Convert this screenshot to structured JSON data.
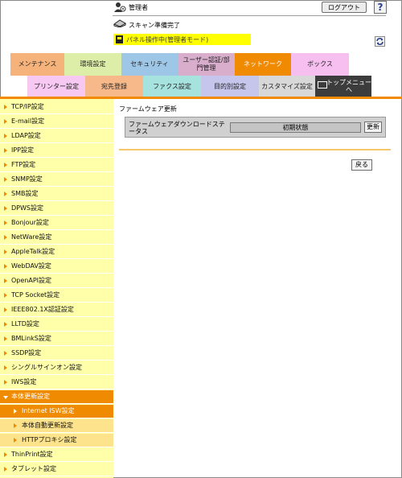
{
  "header": {
    "admin_label": "管理者",
    "logout_label": "ログアウト",
    "help_label": "?",
    "scan_status": "スキャン準備完了",
    "panel_status": "パネル操作中(管理者モード)"
  },
  "main_tabs": [
    {
      "label": "メンテナンス",
      "color": "#f5b27a"
    },
    {
      "label": "環境設定",
      "color": "#ddeea8"
    },
    {
      "label": "セキュリティ",
      "color": "#9ec6e6"
    },
    {
      "label": "ユーザー認証/部門管理",
      "color": "#d8aecc"
    },
    {
      "label": "ネットワーク",
      "color": "#f08a00"
    },
    {
      "label": "ボックス",
      "color": "#f6bff0"
    }
  ],
  "sub_tabs": [
    {
      "label": "プリンター設定",
      "color": "#f6c8f2"
    },
    {
      "label": "宛先登録",
      "color": "#f8b98a"
    },
    {
      "label": "ファクス設定",
      "color": "#a6e2de"
    },
    {
      "label": "目的別設定",
      "color": "#c6c6ec"
    },
    {
      "label": "カスタマイズ設定",
      "color": "#d8d8d8"
    },
    {
      "label": "トップメニューへ",
      "color": "#3c3c3c"
    }
  ],
  "sidebar": {
    "items": [
      {
        "label": "TCP/IP設定"
      },
      {
        "label": "E-mail設定"
      },
      {
        "label": "LDAP設定"
      },
      {
        "label": "IPP設定"
      },
      {
        "label": "FTP設定"
      },
      {
        "label": "SNMP設定"
      },
      {
        "label": "SMB設定"
      },
      {
        "label": "DPWS設定"
      },
      {
        "label": "Bonjour設定"
      },
      {
        "label": "NetWare設定"
      },
      {
        "label": "AppleTalk設定"
      },
      {
        "label": "WebDAV設定"
      },
      {
        "label": "OpenAPI設定"
      },
      {
        "label": "TCP Socket設定"
      },
      {
        "label": "IEEE802.1X認証設定"
      },
      {
        "label": "LLTD設定"
      },
      {
        "label": "BMLinkS設定"
      },
      {
        "label": "SSDP設定"
      },
      {
        "label": "シングルサインオン設定"
      },
      {
        "label": "IWS設定"
      },
      {
        "label": "本体更新設定"
      },
      {
        "label": "Internet ISW設定"
      },
      {
        "label": "本体自動更新設定"
      },
      {
        "label": "HTTPプロキシ設定"
      },
      {
        "label": "ThinPrint設定"
      },
      {
        "label": "タブレット設定"
      }
    ]
  },
  "content": {
    "title": "ファームウェア更新",
    "row_label": "ファームウェアダウンロードステータス",
    "status_value": "初期状態",
    "update_label": "更新",
    "back_label": "戻る"
  },
  "colors": {
    "accent": "#f08a00",
    "sidebar_bg": "#ffffaa",
    "sidebar_sub_bg": "#fce38c",
    "banner": "#ffff00"
  }
}
